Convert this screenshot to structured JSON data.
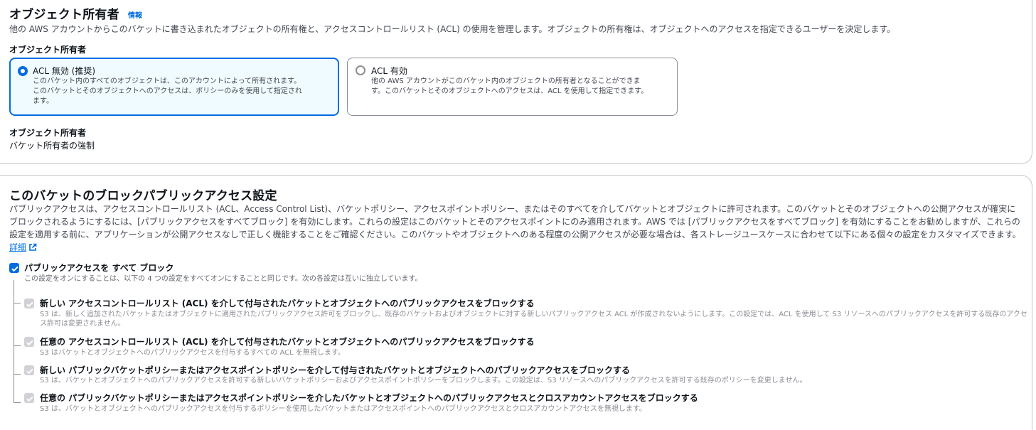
{
  "object_ownership": {
    "title": "オブジェクト所有者",
    "info_link": "情報",
    "description": "他の AWS アカウントからこのバケットに書き込まれたオブジェクトの所有権と、アクセスコントロールリスト (ACL) の使用を管理します。オブジェクトの所有権は、オブジェクトへのアクセスを指定できるユーザーを決定します。",
    "field_label": "オブジェクト所有者",
    "options": [
      {
        "title": "ACL 無効 (推奨)",
        "desc_line1": "このバケット内のすべてのオブジェクトは、このアカウントによって所有されます。",
        "desc_line2": "このバケットとそのオブジェクトへのアクセスは、ポリシーのみを使用して指定され",
        "desc_line3": "ます。",
        "selected": true
      },
      {
        "title": "ACL 有効",
        "desc_line1": "他の AWS アカウントがこのバケット内のオブジェクトの所有者となることができま",
        "desc_line2": "す。このバケットとそのオブジェクトへのアクセスは、ACL を使用して指定できます。",
        "selected": false
      }
    ],
    "summary_label": "オブジェクト所有者",
    "summary_value": "バケット所有者の強制"
  },
  "block_public_access": {
    "title": "このバケットのブロックパブリックアクセス設定",
    "description": "パブリックアクセスは、アクセスコントロールリスト (ACL、Access Control List)、バケットポリシー、アクセスポイントポリシー、またはそのすべてを介してバケットとオブジェクトに許可されます。このバケットとそのオブジェクトへの公開アクセスが確実にブロックされるようにするには、[パブリックアクセスをすべてブロック] を有効にします。これらの設定はこのバケットとそのアクセスポイントにのみ適用されます。AWS では [パブリックアクセスをすべてブロック] を有効にすることをお勧めしますが、これらの設定を適用する前に、アプリケーションが公開アクセスなしで正しく機能することをご確認ください。このバケットやオブジェクトへのある程度の公開アクセスが必要な場合は、各ストレージユースケースに合わせて以下にある個々の設定をカスタマイズできます。",
    "learn_more": "詳細",
    "block_all": {
      "label": "パブリックアクセスを すべて ブロック",
      "description": "この設定をオンにすることは、以下の 4 つの設定をすべてオンにすることと同じです。次の各設定は互いに独立しています。",
      "checked": true
    },
    "settings": [
      {
        "label": "新しい アクセスコントロールリスト (ACL) を介して付与されたバケットとオブジェクトへのパブリックアクセスをブロックする",
        "description": "S3 は、新しく追加されたバケットまたはオブジェクトに適用されたパブリックアクセス許可をブロックし、既存のバケットおよびオブジェクトに対する新しいパブリックアクセス ACL が作成されないようにします。この設定では、ACL を使用して S3 リソースへのパブリックアクセスを許可する既存のアクセス許可は変更されません。"
      },
      {
        "label": "任意の アクセスコントロールリスト (ACL) を介して付与されたバケットとオブジェクトへのパブリックアクセスをブロックする",
        "description": "S3 はバケットとオブジェクトへのパブリックアクセスを付与するすべての ACL を無視します。"
      },
      {
        "label": "新しい パブリックバケットポリシーまたはアクセスポイントポリシーを介して付与されたバケットとオブジェクトへのパブリックアクセスをブロックする",
        "description": "S3 は、バケットとオブジェクトへのパブリックアクセスを許可する新しいバケットポリシーおよびアクセスポイントポリシーをブロックします。この設定は、S3 リソースへのパブリックアクセスを許可する既存のポリシーを変更しません。"
      },
      {
        "label": "任意の パブリックバケットポリシーまたはアクセスポイントポリシーを介したバケットとオブジェクトへのパブリックアクセスとクロスアカウントアクセスをブロックする",
        "description": "S3 は、バケットとオブジェクトへのパブリックアクセスを付与するポリシーを使用したバケットまたはアクセスポイントへのパブリックアクセスとクロスアカウントアクセスを無視します。"
      }
    ]
  },
  "colors": {
    "primary": "#006ce0",
    "selected_tile_bg": "#f0fbff",
    "disabled_checkbox": "#d1d1d6",
    "border": "#c6c6cd"
  },
  "icons": {
    "external_link": "external-link-icon",
    "check": "check-icon"
  }
}
